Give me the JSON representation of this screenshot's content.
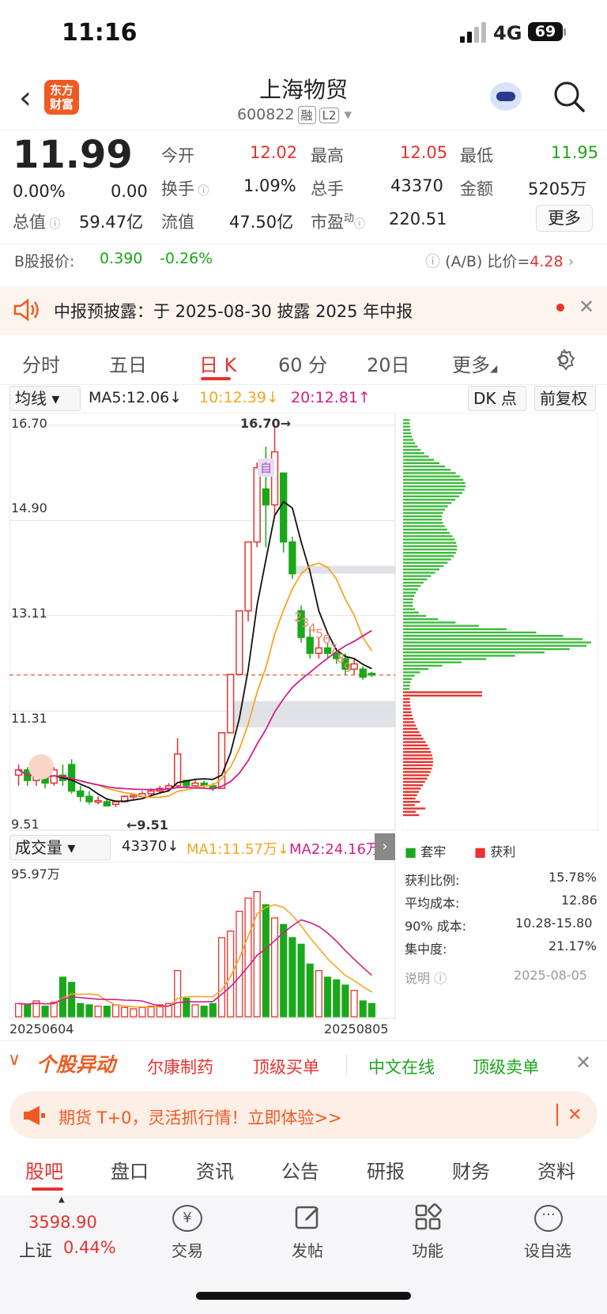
{
  "status": {
    "time": "11:16",
    "network": "4G",
    "battery": "69"
  },
  "header": {
    "back_icon": "chevron-left-icon",
    "logo_text": "东方财富",
    "name": "上海物贸",
    "code": "600822",
    "tag1": "融",
    "tag2": "L2"
  },
  "quote": {
    "price": "11.99",
    "change_pct": "0.00%",
    "change": "0.00",
    "open_label": "今开",
    "open": "12.02",
    "high_label": "最高",
    "high": "12.05",
    "low_label": "最低",
    "low": "11.95",
    "turnover_label": "换手",
    "turnover": "1.09%",
    "volume_label": "总手",
    "volume": "43370",
    "amount_label": "金额",
    "amount": "5205万",
    "mktcap_label": "总值",
    "mktcap": "59.47亿",
    "float_label": "流值",
    "float": "47.50亿",
    "pe_label": "市盈",
    "pe_sup": "动",
    "pe": "220.51",
    "more": "更多"
  },
  "bshare": {
    "label": "B股报价:",
    "price": "0.390",
    "pct": "-0.26%",
    "ratio_label": "(A/B) 比价=",
    "ratio": "4.28"
  },
  "notice": {
    "text": "中报预披露：于 2025-08-30 披露 2025 年中报"
  },
  "tabs": [
    "分时",
    "五日",
    "日 K",
    "60 分",
    "20日",
    "更多"
  ],
  "ma": {
    "selector": "均线",
    "ma5": "MA5:12.06",
    "ma10": "10:12.39",
    "ma20": "20:12.81",
    "dk": "DK 点",
    "fq": "前复权"
  },
  "kline_axis": [
    "16.70",
    "14.90",
    "13.11",
    "11.31",
    "9.51"
  ],
  "kline_labels": {
    "high": "16.70→",
    "low": "←9.51",
    "zi": "自"
  },
  "volume_bar": {
    "selector": "成交量",
    "vol": "43370",
    "ma1": "MA1:11.57万",
    "ma2": "MA2:24.16万",
    "max": "95.97万",
    "date_start": "20250604",
    "date_end": "20250805"
  },
  "chip": {
    "legend_trap": "套牢",
    "legend_profit": "获利",
    "rows": [
      {
        "k": "获利比例:",
        "v": "15.78%"
      },
      {
        "k": "平均成本:",
        "v": "12.86"
      },
      {
        "k": "90% 成本:",
        "v": "10.28-15.80"
      },
      {
        "k": "集中度:",
        "v": "21.17%"
      }
    ],
    "note": "说明",
    "date": "2025-08-05"
  },
  "hot": {
    "title": "个股异动",
    "items": [
      "尔康制药",
      "顶级买单",
      "中文在线",
      "顶级卖单"
    ]
  },
  "ad": {
    "text": "期货 T+0，灵活抓行情！立即体验>>"
  },
  "bottom_tabs": [
    "股吧",
    "盘口",
    "资讯",
    "公告",
    "研报",
    "财务",
    "资料"
  ],
  "footer": {
    "index_val": "3598.90",
    "index_name": "上证",
    "index_pct": "0.44%",
    "items": [
      "交易",
      "发帖",
      "功能",
      "设自选"
    ]
  },
  "colors": {
    "up": "#e8322e",
    "down": "#1aa81a",
    "accent": "#f05a22"
  },
  "chart_data": {
    "type": "candlestick",
    "price_ticks": [
      "16.70",
      "14.90",
      "13.11",
      "11.31",
      "9.51"
    ],
    "ylim": [
      9.51,
      16.7
    ],
    "highest": "16.70",
    "lowest": "9.51",
    "current": "11.99",
    "candles": [
      [
        10.1,
        10.2,
        9.9,
        10.3
      ],
      [
        10.2,
        10.0,
        9.9,
        10.25
      ],
      [
        10.0,
        10.1,
        9.9,
        10.2
      ],
      [
        10.05,
        9.95,
        9.85,
        10.1
      ],
      [
        9.95,
        10.2,
        9.9,
        10.25
      ],
      [
        10.1,
        10.0,
        9.9,
        10.3
      ],
      [
        10.3,
        9.8,
        9.75,
        10.4
      ],
      [
        9.8,
        9.7,
        9.6,
        9.9
      ],
      [
        9.7,
        9.6,
        9.55,
        9.8
      ],
      [
        9.6,
        9.62,
        9.55,
        9.7
      ],
      [
        9.6,
        9.52,
        9.51,
        9.65
      ],
      [
        9.55,
        9.6,
        9.5,
        9.62
      ],
      [
        9.6,
        9.7,
        9.58,
        9.72
      ],
      [
        9.7,
        9.72,
        9.65,
        9.75
      ],
      [
        9.7,
        9.75,
        9.68,
        9.8
      ],
      [
        9.75,
        9.8,
        9.7,
        9.85
      ],
      [
        9.8,
        9.85,
        9.75,
        9.9
      ],
      [
        9.85,
        9.9,
        9.8,
        9.95
      ],
      [
        9.9,
        10.5,
        9.85,
        10.8
      ],
      [
        10.0,
        9.9,
        9.85,
        10.0
      ],
      [
        9.9,
        9.95,
        9.85,
        10.0
      ],
      [
        9.95,
        9.9,
        9.85,
        10.0
      ],
      [
        9.9,
        9.85,
        9.8,
        9.95
      ],
      [
        9.85,
        10.9,
        9.85,
        10.9
      ],
      [
        10.9,
        12.0,
        10.9,
        12.0
      ],
      [
        12.0,
        13.2,
        12.0,
        13.2
      ],
      [
        13.2,
        14.5,
        13.0,
        14.5
      ],
      [
        14.5,
        15.9,
        14.4,
        16.0
      ],
      [
        15.5,
        15.2,
        14.4,
        16.3
      ],
      [
        15.2,
        16.2,
        15.0,
        16.7
      ],
      [
        15.8,
        14.5,
        14.3,
        15.8
      ],
      [
        14.5,
        13.9,
        13.8,
        14.6
      ],
      [
        13.2,
        12.7,
        12.6,
        13.3
      ],
      [
        12.7,
        12.4,
        12.3,
        12.9
      ],
      [
        12.4,
        12.5,
        12.3,
        12.7
      ],
      [
        12.5,
        12.4,
        12.3,
        12.6
      ],
      [
        12.4,
        12.3,
        12.2,
        12.5
      ],
      [
        12.3,
        12.1,
        12.0,
        12.4
      ],
      [
        12.1,
        12.2,
        12.0,
        12.3
      ],
      [
        12.1,
        11.95,
        11.9,
        12.15
      ],
      [
        12.02,
        11.99,
        11.95,
        12.05
      ]
    ],
    "volume_max": "95.97万"
  }
}
